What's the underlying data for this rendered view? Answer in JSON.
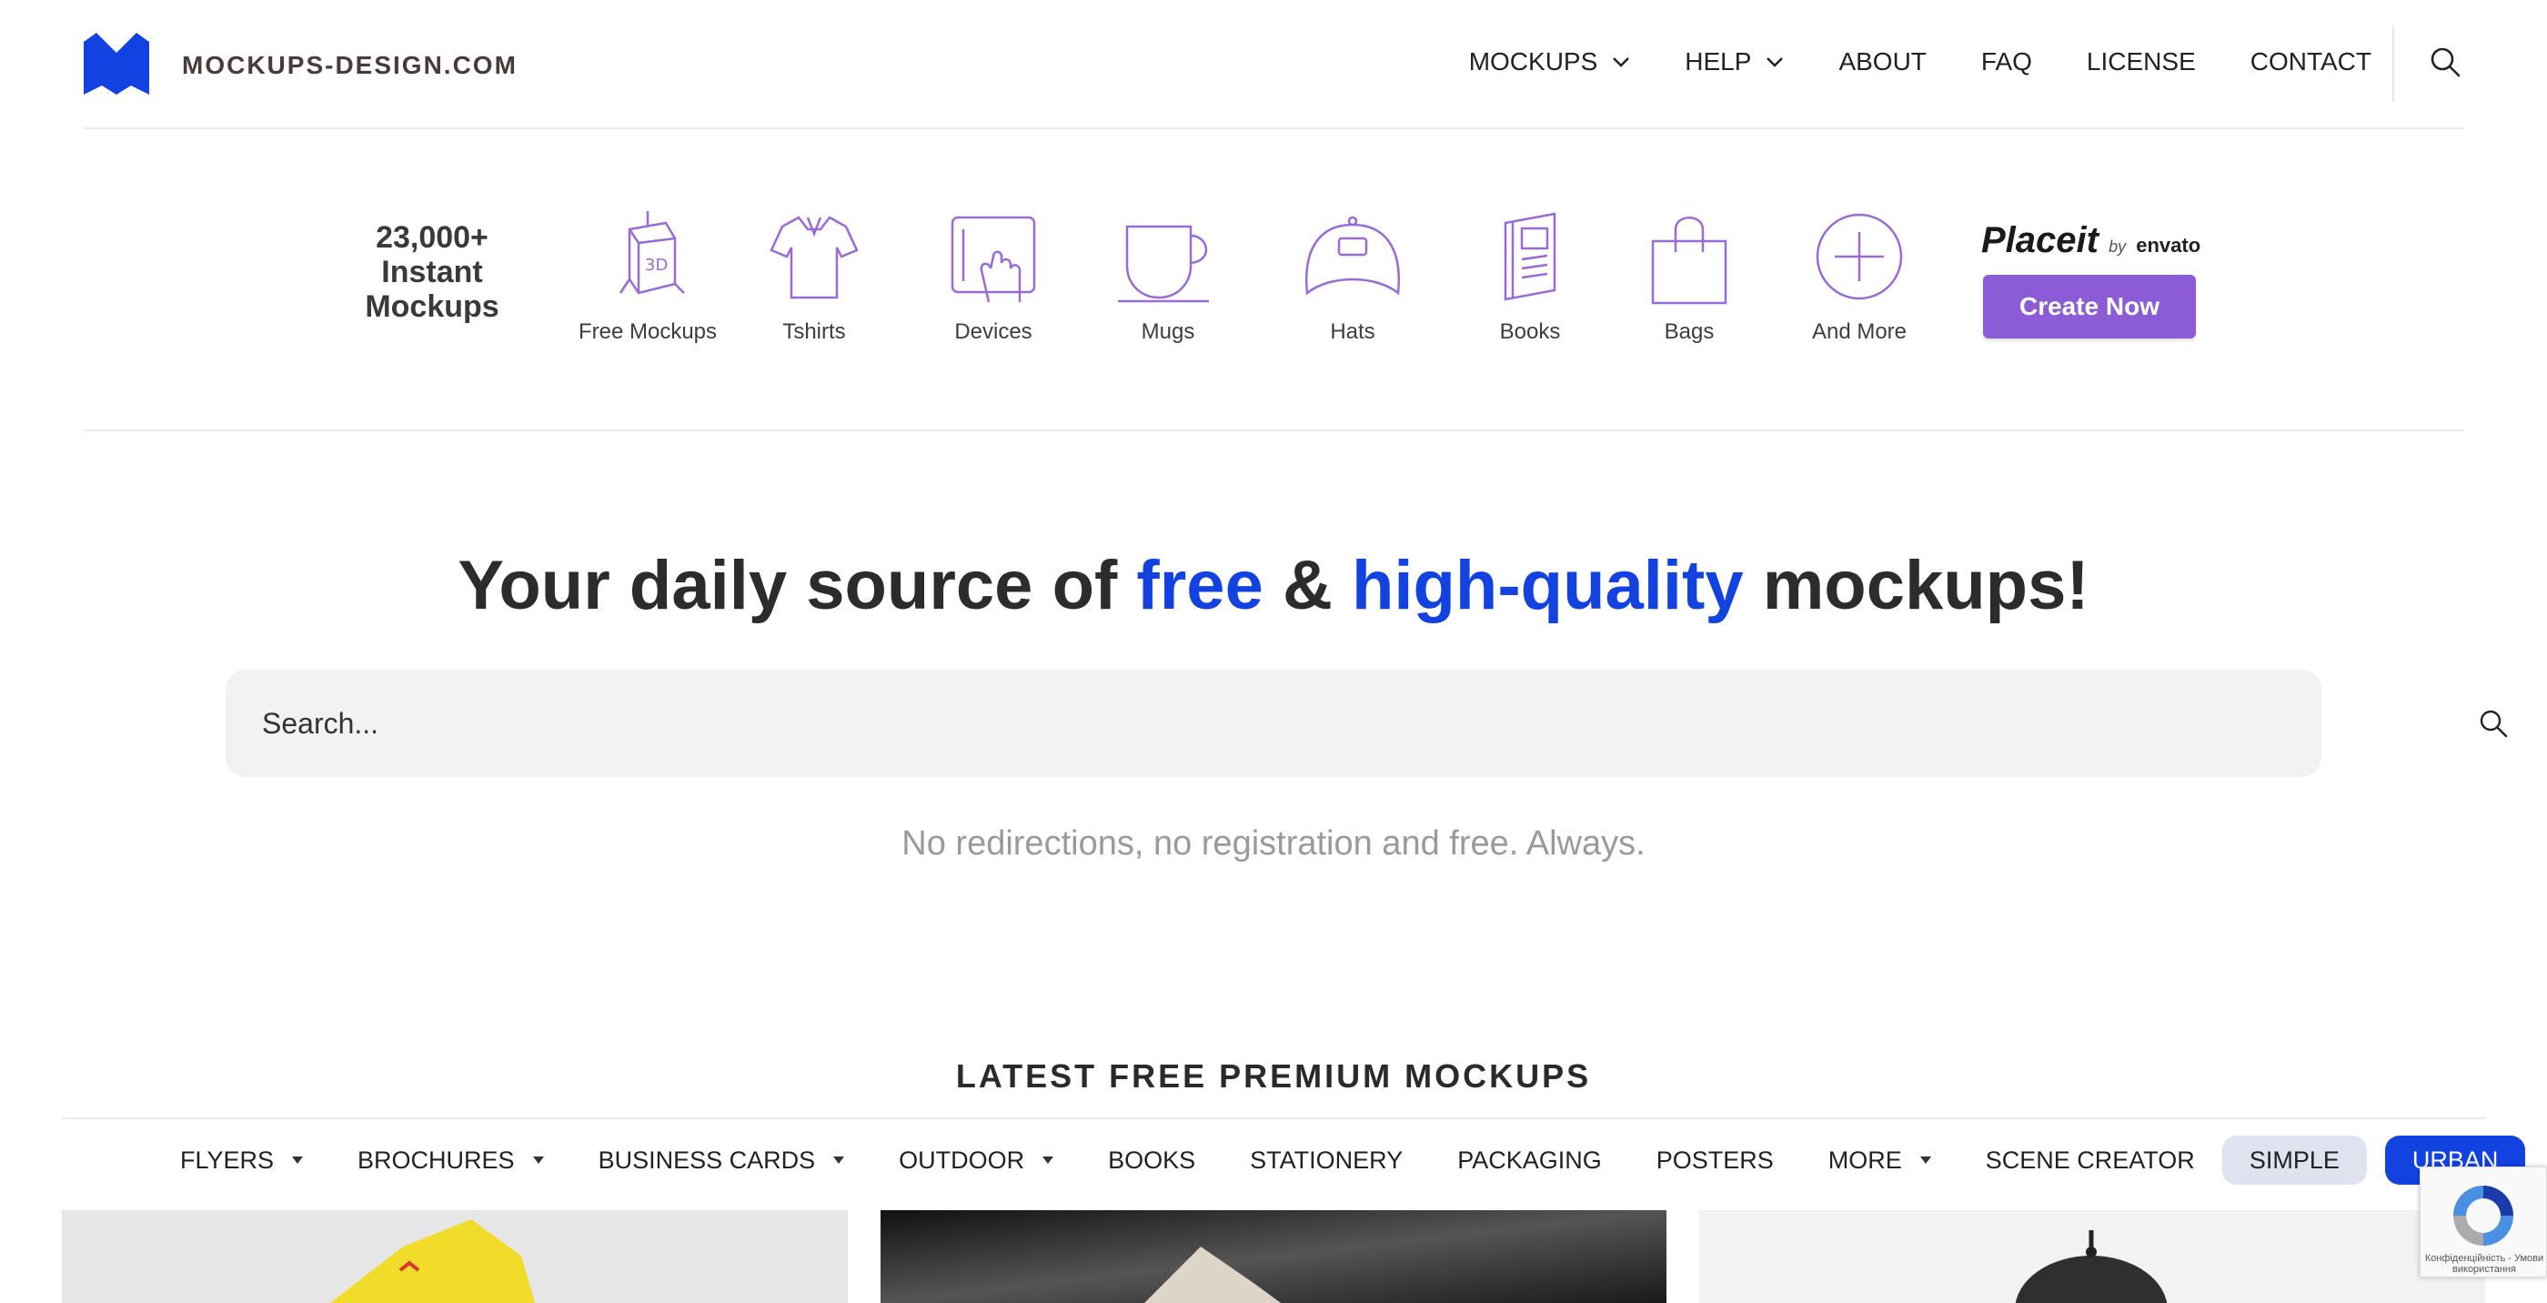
{
  "header": {
    "logo_text": "MOCKUPS-DESIGN.COM",
    "nav": [
      {
        "label": "MOCKUPS",
        "dropdown": true
      },
      {
        "label": "HELP",
        "dropdown": true
      },
      {
        "label": "ABOUT",
        "dropdown": false
      },
      {
        "label": "FAQ",
        "dropdown": false
      },
      {
        "label": "LICENSE",
        "dropdown": false
      },
      {
        "label": "CONTACT",
        "dropdown": false
      }
    ]
  },
  "banner": {
    "count_line1": "23,000+",
    "count_line2": "Instant",
    "count_line3": "Mockups",
    "categories": [
      {
        "label": "Free Mockups",
        "icon": "3d-box-icon"
      },
      {
        "label": "Tshirts",
        "icon": "tshirt-icon"
      },
      {
        "label": "Devices",
        "icon": "device-icon"
      },
      {
        "label": "Mugs",
        "icon": "mug-icon"
      },
      {
        "label": "Hats",
        "icon": "hat-icon"
      },
      {
        "label": "Books",
        "icon": "book-icon"
      },
      {
        "label": "Bags",
        "icon": "bag-icon"
      },
      {
        "label": "And More",
        "icon": "plus-circle-icon"
      }
    ],
    "placeit_brand": "Placeit",
    "placeit_by": "by",
    "placeit_envato": "envato",
    "cta_label": "Create Now",
    "accent_color": "#8c5bd6"
  },
  "hero": {
    "title_part1": "Your daily source of ",
    "title_free": "free",
    "title_amp": " & ",
    "title_hq": "high-quality",
    "title_part2": " mockups!",
    "highlight_color": "#1242e0",
    "search_placeholder": "Search...",
    "tagline": "No redirections, no registration and free. Always."
  },
  "latest": {
    "title": "LATEST FREE PREMIUM MOCKUPS",
    "filters": [
      {
        "label": "FLYERS",
        "dropdown": true
      },
      {
        "label": "BROCHURES",
        "dropdown": true
      },
      {
        "label": "BUSINESS CARDS",
        "dropdown": true
      },
      {
        "label": "OUTDOOR",
        "dropdown": true
      },
      {
        "label": "BOOKS",
        "dropdown": false
      },
      {
        "label": "STATIONERY",
        "dropdown": false
      },
      {
        "label": "PACKAGING",
        "dropdown": false
      },
      {
        "label": "POSTERS",
        "dropdown": false
      },
      {
        "label": "MORE",
        "dropdown": true
      },
      {
        "label": "SCENE CREATOR",
        "dropdown": false
      }
    ],
    "pill_simple": "SIMPLE",
    "pill_urban": "URBAN"
  },
  "recaptcha": {
    "text": "Конфіденційність - Умови використання"
  }
}
